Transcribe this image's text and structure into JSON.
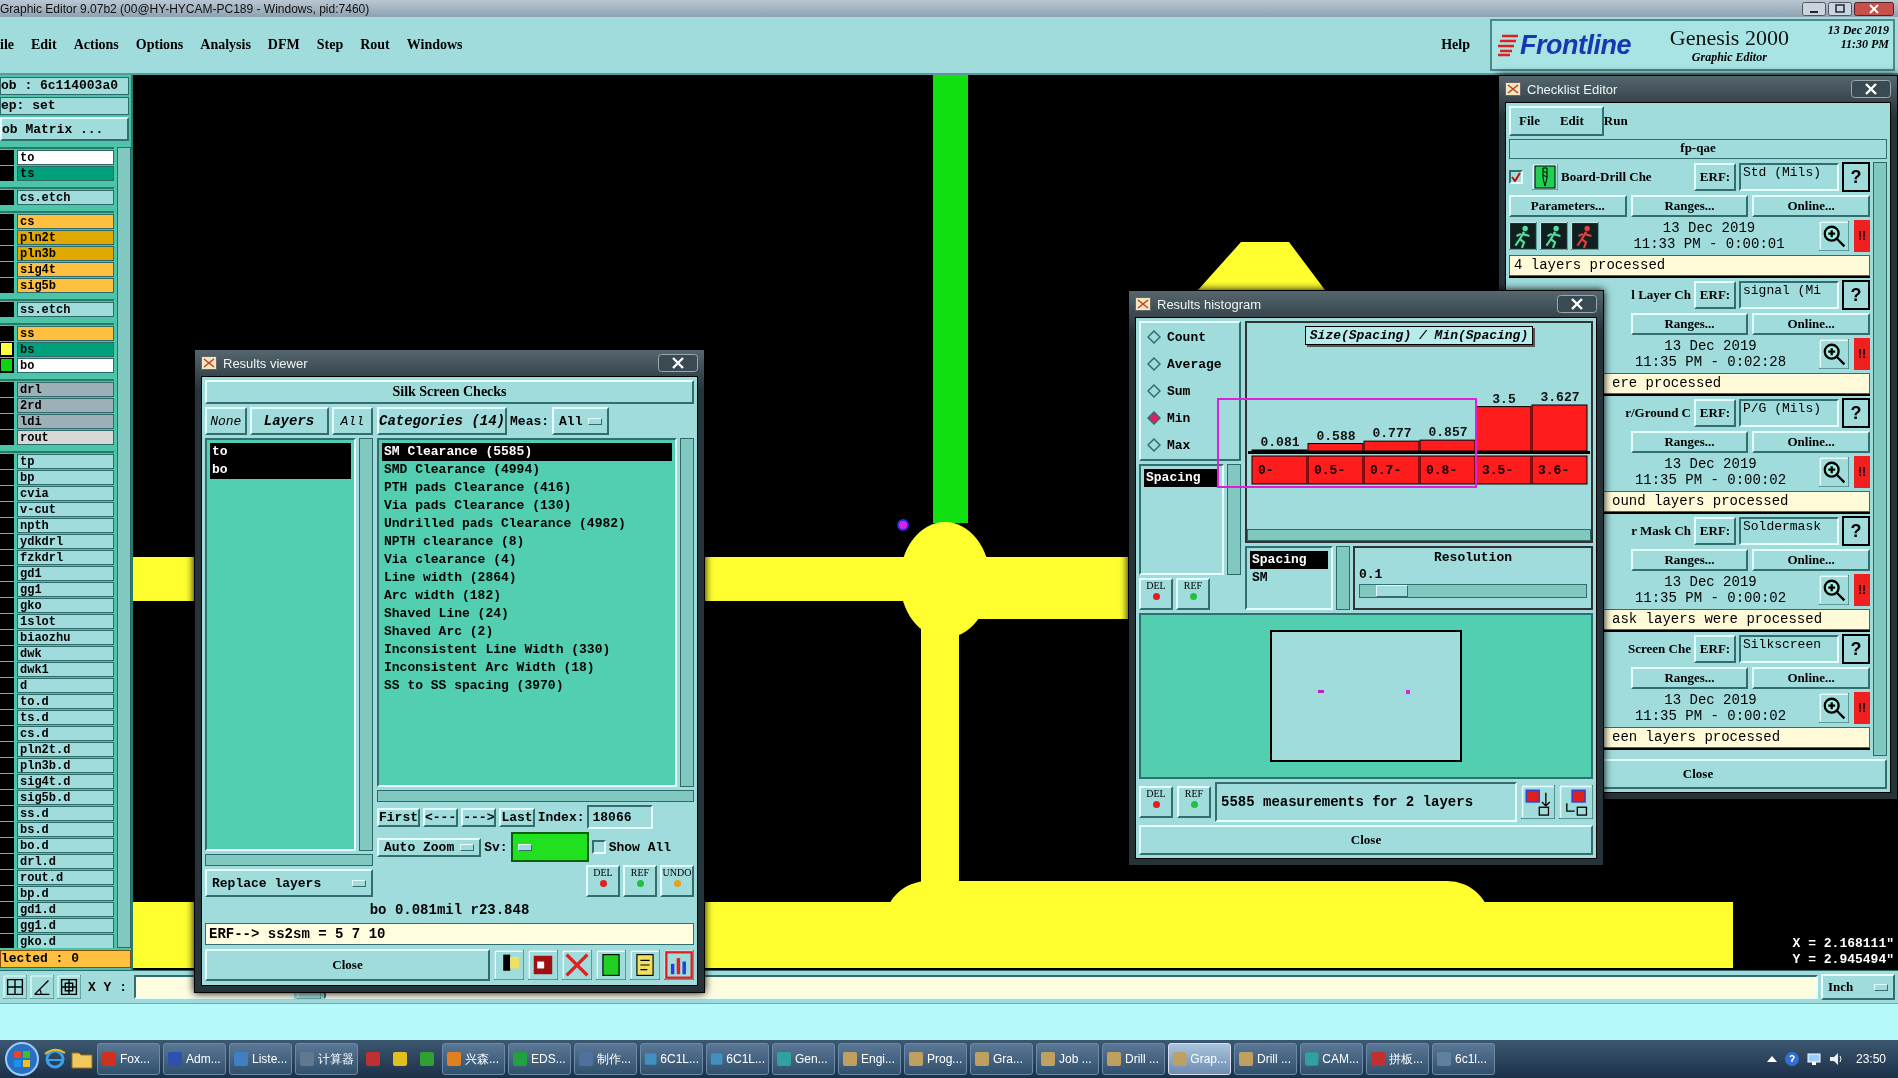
{
  "title_bar": {
    "title": "Graphic Editor 9.07b2 (00@HY-HYCAM-PC189 - Windows, pid:7460)"
  },
  "menu": [
    "ile",
    "Edit",
    "Actions",
    "Options",
    "Analysis",
    "DFM",
    "Step",
    "Rout",
    "Windows"
  ],
  "help": "Help",
  "brand": {
    "logo": "Frontline",
    "product": "Genesis 2000",
    "subtitle": "Graphic Editor",
    "date": "13 Dec 2019",
    "time": "11:30 PM"
  },
  "left_panel": {
    "job": "ob : 6c114003a0",
    "step": "ep: set",
    "matrix_button": "ob Matrix ...",
    "selected_count": "lected : 0",
    "layer_groups": [
      [
        {
          "name": "to",
          "color": "#ffffff"
        },
        {
          "name": "ts",
          "color": "#00a07a"
        }
      ],
      [
        {
          "name": "cs.etch",
          "color": "#a0dcdc"
        }
      ],
      [
        {
          "name": "cs",
          "color": "#ffc040"
        },
        {
          "name": "pln2t",
          "color": "#e0a800"
        },
        {
          "name": "pln3b",
          "color": "#e0a800"
        },
        {
          "name": "sig4t",
          "color": "#ffc040"
        },
        {
          "name": "sig5b",
          "color": "#ffc040"
        }
      ],
      [
        {
          "name": "ss.etch",
          "color": "#a0dcdc"
        }
      ],
      [
        {
          "name": "ss",
          "color": "#ffc040"
        },
        {
          "name": "bs",
          "color": "#00a07a",
          "marker": {
            "color": "#ffff40"
          }
        },
        {
          "name": "bo",
          "color": "#ffffff",
          "marker": {
            "color": "#10d010"
          }
        }
      ],
      [
        {
          "name": "drl",
          "color": "#9cb0b8"
        },
        {
          "name": "2rd",
          "color": "#9cb0b8"
        },
        {
          "name": "ldi",
          "color": "#9cb0b8"
        },
        {
          "name": "rout",
          "color": "#d8d8d8"
        }
      ],
      [
        {
          "name": "tp",
          "color": "#a0dcdc"
        },
        {
          "name": "bp",
          "color": "#a0dcdc"
        },
        {
          "name": "cvia",
          "color": "#a0dcdc"
        },
        {
          "name": "v-cut",
          "color": "#a0dcdc"
        },
        {
          "name": "npth",
          "color": "#a0dcdc"
        },
        {
          "name": "ydkdrl",
          "color": "#a0dcdc"
        },
        {
          "name": "fzkdrl",
          "color": "#a0dcdc"
        },
        {
          "name": "gd1",
          "color": "#a0dcdc"
        },
        {
          "name": "gg1",
          "color": "#a0dcdc"
        },
        {
          "name": "gko",
          "color": "#a0dcdc"
        },
        {
          "name": "1slot",
          "color": "#a0dcdc"
        },
        {
          "name": "biaozhu",
          "color": "#a0dcdc"
        },
        {
          "name": "dwk",
          "color": "#a0dcdc"
        },
        {
          "name": "dwk1",
          "color": "#a0dcdc"
        },
        {
          "name": "d",
          "color": "#a0dcdc"
        },
        {
          "name": "to.d",
          "color": "#a0dcdc"
        },
        {
          "name": "ts.d",
          "color": "#a0dcdc"
        },
        {
          "name": "cs.d",
          "color": "#a0dcdc"
        },
        {
          "name": "pln2t.d",
          "color": "#a0dcdc"
        },
        {
          "name": "pln3b.d",
          "color": "#a0dcdc"
        },
        {
          "name": "sig4t.d",
          "color": "#a0dcdc"
        },
        {
          "name": "sig5b.d",
          "color": "#a0dcdc"
        },
        {
          "name": "ss.d",
          "color": "#a0dcdc"
        },
        {
          "name": "bs.d",
          "color": "#a0dcdc"
        },
        {
          "name": "bo.d",
          "color": "#a0dcdc"
        },
        {
          "name": "drl.d",
          "color": "#a0dcdc"
        },
        {
          "name": "rout.d",
          "color": "#a0dcdc"
        },
        {
          "name": "bp.d",
          "color": "#a0dcdc"
        },
        {
          "name": "gd1.d",
          "color": "#a0dcdc"
        },
        {
          "name": "gg1.d",
          "color": "#a0dcdc"
        },
        {
          "name": "gko.d",
          "color": "#a0dcdc"
        }
      ]
    ]
  },
  "canvas": {
    "coordinates": [
      "X = 2.168111\"",
      "Y = 2.945494\""
    ]
  },
  "bottom_bar": {
    "xy_label": "X Y :",
    "units": "Inch"
  },
  "results_viewer": {
    "title": "Results viewer",
    "heading": "Silk Screen Checks",
    "layer_buttons": [
      "None",
      "Layers",
      "All"
    ],
    "layers": [
      {
        "name": "to",
        "selected": true
      },
      {
        "name": "bo",
        "selected": true
      }
    ],
    "replace_menu": "Replace layers",
    "categories_button": "Categories (14)",
    "meas_label": "Meas:",
    "meas_value": "All",
    "categories": [
      {
        "label": "SM Clearance (5585)",
        "selected": true
      },
      {
        "label": "SMD Clearance (4994)",
        "selected": false
      },
      {
        "label": "PTH pads Clearance (416)",
        "selected": false
      },
      {
        "label": "Via pads Clearance (130)",
        "selected": false
      },
      {
        "label": "Undrilled pads Clearance (4982)",
        "selected": false
      },
      {
        "label": "NPTH clearance (8)",
        "selected": false
      },
      {
        "label": "Via clearance (4)",
        "selected": false
      },
      {
        "label": "Line width (2864)",
        "selected": false
      },
      {
        "label": "Arc width (182)",
        "selected": false
      },
      {
        "label": "Shaved Line (24)",
        "selected": false
      },
      {
        "label": "Shaved Arc (2)",
        "selected": false
      },
      {
        "label": "Inconsistent Line Width (330)",
        "selected": false
      },
      {
        "label": "Inconsistent Arc Width (18)",
        "selected": false
      },
      {
        "label": "SS to SS spacing (3970)",
        "selected": false
      }
    ],
    "nav": [
      "First",
      "<---",
      "--->",
      "Last"
    ],
    "index_label": "Index:",
    "index": "18066",
    "zoom_menu": "Auto Zoom",
    "sv_label": "Sv:",
    "sv": {
      "color": "#20e020"
    },
    "show_all": {
      "label": "Show All",
      "checked": false
    },
    "tools": [
      "DEL",
      "REF",
      "UNDO"
    ],
    "measure": "bo 0.081mil r23.848",
    "erf": "ERF--> ss2sm = 5 7 10",
    "close": "Close"
  },
  "histogram": {
    "title": "Results histogram",
    "modes": [
      {
        "label": "Count",
        "selected": false
      },
      {
        "label": "Average",
        "selected": false
      },
      {
        "label": "Sum",
        "selected": false
      },
      {
        "label": "Min",
        "selected": true
      },
      {
        "label": "Max",
        "selected": false
      }
    ],
    "measures": [
      {
        "label": "Spacing",
        "selected": true
      }
    ],
    "tools": [
      "DEL",
      "REF"
    ],
    "status_tools": [
      "DEL",
      "REF"
    ],
    "chart_data": {
      "type": "bar",
      "title": "Size(Spacing) / Min(Spacing)",
      "categories": [
        "0-",
        "0.5-",
        "0.7-",
        "0.8-",
        "3.5-",
        "3.6-"
      ],
      "series": [
        {
          "color": "#ff1c1c",
          "values": [
            0.081,
            0.588,
            0.777,
            0.857,
            3.5,
            3.627
          ]
        }
      ],
      "data_labels": true
    },
    "rubber_band": true,
    "sublist": [
      {
        "label": "Spacing",
        "selected": true
      },
      {
        "label": "SM",
        "selected": false
      }
    ],
    "resolution": {
      "label": "Resolution",
      "value": "0.1",
      "level": 0.07
    },
    "status": "5585 measurements for 2 layers",
    "close": "Close"
  },
  "checklist": {
    "title": "Checklist Editor",
    "menu": [
      "File",
      "Edit",
      "Run"
    ],
    "name": "fp-qae",
    "close": "Close",
    "checks": [
      {
        "kind": "full",
        "checked": true,
        "name": "Board-Drill Che",
        "erf_label": "ERF:",
        "erf": "Std (Mils)",
        "help": "?",
        "buttons": [
          "Parameters...",
          "Ranges...",
          "Online..."
        ],
        "date": "13 Dec 2019",
        "time": "11:33 PM - 0:00:01",
        "alert": "!!",
        "status": "4 layers processed"
      },
      {
        "kind": "partial",
        "name": "l Layer Ch",
        "erf_label": "ERF:",
        "erf": "signal (Mi",
        "help": "?",
        "buttons": [
          "Ranges...",
          "Online..."
        ],
        "date": "13 Dec 2019",
        "time": "11:35 PM - 0:02:28",
        "alert": "!!",
        "status": "ere processed"
      },
      {
        "kind": "partial",
        "name": "r/Ground C",
        "erf_label": "ERF:",
        "erf": "P/G (Mils)",
        "help": "?",
        "buttons": [
          "Ranges...",
          "Online..."
        ],
        "date": "13 Dec 2019",
        "time": "11:35 PM - 0:00:02",
        "alert": "!!",
        "status": "ound layers processed"
      },
      {
        "kind": "partial",
        "name": "r Mask Ch",
        "erf_label": "ERF:",
        "erf": "Soldermask",
        "help": "?",
        "buttons": [
          "Ranges...",
          "Online..."
        ],
        "date": "13 Dec 2019",
        "time": "11:35 PM - 0:00:02",
        "alert": "!!",
        "status": "ask layers were processed"
      },
      {
        "kind": "partial",
        "name": "Screen Che",
        "erf_label": "ERF:",
        "erf": "Silkscreen",
        "help": "?",
        "buttons": [
          "Ranges...",
          "Online..."
        ],
        "date": "13 Dec 2019",
        "time": "11:35 PM - 0:00:02",
        "alert": "!!",
        "status": "een layers processed"
      }
    ]
  },
  "taskbar": {
    "clock": "23:50",
    "tasks": [
      {
        "kind": "button",
        "label": "Fox...",
        "color": "#d03020",
        "selected": false
      },
      {
        "kind": "button",
        "label": "Adm...",
        "color": "#3050b0",
        "selected": false
      },
      {
        "kind": "button",
        "label": "Liste...",
        "color": "#4080c0",
        "selected": false
      },
      {
        "kind": "button",
        "label": "计算器",
        "color": "#607890",
        "selected": false
      },
      {
        "kind": "icon",
        "color": "#c03030",
        "selected": false
      },
      {
        "kind": "icon",
        "color": "#e0c020",
        "selected": false
      },
      {
        "kind": "icon",
        "color": "#30a030",
        "selected": false
      },
      {
        "kind": "button",
        "label": "兴森...",
        "color": "#e08020",
        "selected": false
      },
      {
        "kind": "button",
        "label": "EDS...",
        "color": "#20a040",
        "selected": false
      },
      {
        "kind": "button",
        "label": "制作...",
        "color": "#5070a0",
        "selected": false
      },
      {
        "kind": "button",
        "label": "6C1L...",
        "color": "#4090c0",
        "selected": false
      },
      {
        "kind": "button",
        "label": "6C1L...",
        "color": "#4090c0",
        "selected": false
      },
      {
        "kind": "button",
        "label": "Gen...",
        "color": "#30a0a0",
        "selected": false
      },
      {
        "kind": "button",
        "label": "Engi...",
        "color": "#c0a060",
        "selected": false
      },
      {
        "kind": "button",
        "label": "Prog...",
        "color": "#c0a060",
        "selected": false
      },
      {
        "kind": "button",
        "label": "Gra...",
        "color": "#c0a060",
        "selected": false
      },
      {
        "kind": "button",
        "label": "Job ...",
        "color": "#c0a060",
        "selected": false
      },
      {
        "kind": "button",
        "label": "Drill ...",
        "color": "#c0a060",
        "selected": false
      },
      {
        "kind": "button",
        "label": "Grap...",
        "color": "#c0a060",
        "selected": true
      },
      {
        "kind": "button",
        "label": "Drill ...",
        "color": "#c0a060",
        "selected": false
      },
      {
        "kind": "button",
        "label": "CAM...",
        "color": "#30a0a0",
        "selected": false
      },
      {
        "kind": "button",
        "label": "拼板...",
        "color": "#c03030",
        "selected": false
      },
      {
        "kind": "button",
        "label": "6c1l...",
        "color": "#6080a0",
        "selected": false
      }
    ]
  }
}
